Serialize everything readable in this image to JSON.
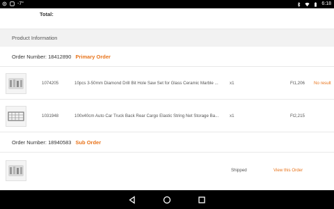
{
  "status_bar": {
    "time": "6:18",
    "left_icons": [
      "settings-icon",
      "notification-icon",
      "temperature-icon"
    ],
    "right_icons": [
      "bluetooth-icon",
      "wifi-icon",
      "battery-icon"
    ],
    "temp_text": "-7°"
  },
  "total": {
    "label": "Total:"
  },
  "product_info": {
    "header": "Product Information"
  },
  "orders": [
    {
      "number_label": "Order Number: 18412890",
      "tag": "Primary Order",
      "items": [
        {
          "id": "1074205",
          "name": "10pcs 3-50mm Diamond Drill Bit Hole Saw Set for Glass Ceramic Marble ...",
          "qty": "x1",
          "price": "Ft1,206",
          "status": "No result"
        },
        {
          "id": "1031948",
          "name": "100x40cm Auto Car Truck Back Rear Cargo Elastic String Net Storage Ba...",
          "qty": "x1",
          "price": "Ft2,215",
          "status": ""
        }
      ]
    },
    {
      "number_label": "Order Number: 18940583",
      "tag": "Sub Order",
      "items": [
        {
          "status": "Shipped",
          "link": "View this Order"
        }
      ]
    }
  ],
  "colors": {
    "accent": "#e8731a",
    "section_bg": "#f2f2f2",
    "divider": "#e8e8e8"
  },
  "navigation_bar": [
    "back-icon",
    "home-icon",
    "recents-icon"
  ]
}
